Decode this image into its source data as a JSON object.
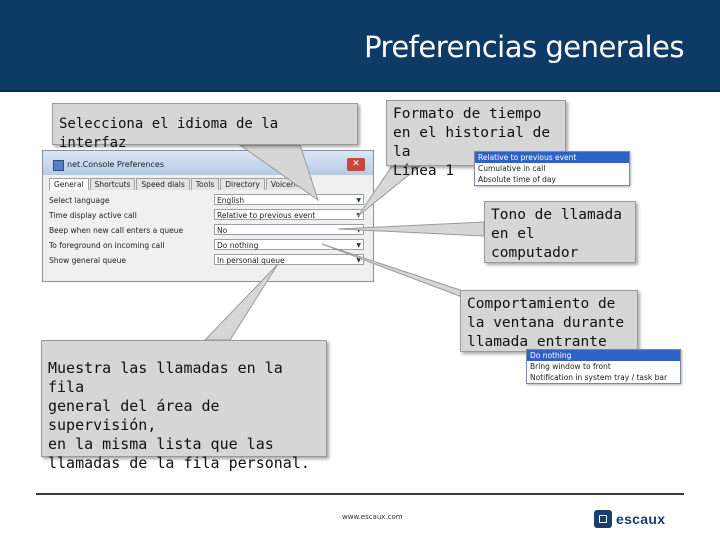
{
  "slide": {
    "title": "Preferencias generales",
    "colors": {
      "header_bg": "#0e3b66",
      "callout_bg": "#d6d6d6",
      "selected_option": "#2f62c6"
    }
  },
  "callouts": {
    "language": "Selecciona el idioma de la interfaz",
    "time_format": "Formato de tiempo\nen el historial de la\nLínea 1",
    "ring_tone": "Tono de llamada\nen el\ncomputador",
    "window_behavior": "Comportamiento de\nla ventana durante\nllamada entrante",
    "general_queue": "Muestra las llamadas en la fila\ngeneral del área de supervisión,\nen la misma lista que las\nllamadas de la fila personal."
  },
  "dialog": {
    "title": "net.Console Preferences",
    "close_label": "✕",
    "tabs": [
      "General",
      "Shortcuts",
      "Speed dials",
      "Tools",
      "Directory",
      "Voicemail"
    ],
    "rows": [
      {
        "label": "Select language",
        "value": "English"
      },
      {
        "label": "Time display active call",
        "value": "Relative to previous event"
      },
      {
        "label": "Beep when new call enters a queue",
        "value": "No"
      },
      {
        "label": "To foreground on incoming call",
        "value": "Do nothing"
      },
      {
        "label": "Show general queue",
        "value": "In personal queue"
      }
    ]
  },
  "dropdown_time": [
    "Relative to previous event",
    "Cumulative in call",
    "Absolute time of day"
  ],
  "dropdown_foreground": [
    "Do nothing",
    "Bring window to front",
    "Notification in system tray / task bar"
  ],
  "footer": {
    "url": "www.escaux.com",
    "logo_text": "escaux"
  }
}
